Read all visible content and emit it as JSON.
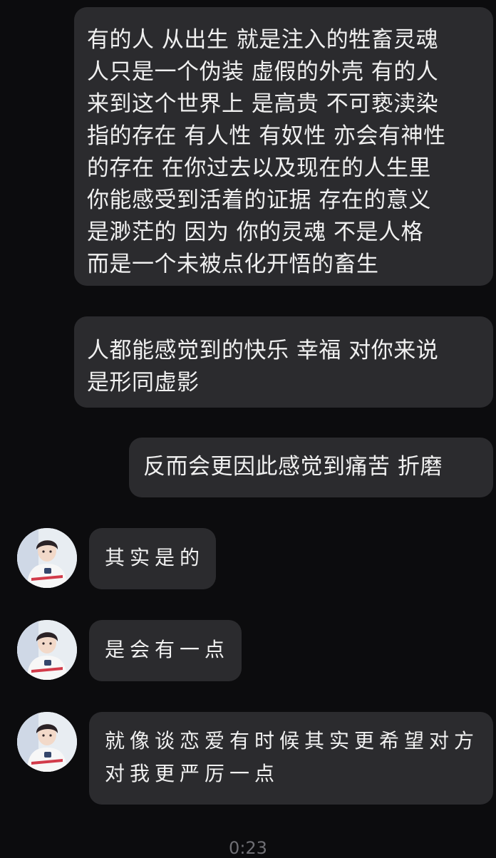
{
  "theme": {
    "background": "#0c0c0e",
    "bubble_color": "#2b2b2e",
    "text_color": "#f0f0f0"
  },
  "messages": [
    {
      "sender": "me",
      "lines": [
        "有的人 从出生 就是注入的牲畜灵魂",
        "人只是一个伪装 虚假的外壳 有的人",
        "来到这个世界上 是高贵 不可亵渎染",
        "指的存在 有人性 有奴性 亦会有神性",
        "的存在 在你过去以及现在的人生里",
        "你能感受到活着的证据 存在的意义",
        "是渺茫的 因为 你的灵魂 不是人格",
        "而是一个未被点化开悟的畜生"
      ]
    },
    {
      "sender": "me",
      "lines": [
        "人都能感觉到的快乐 幸福 对你来说",
        "是形同虚影"
      ]
    },
    {
      "sender": "me",
      "lines": [
        "反而会更因此感觉到痛苦 折磨"
      ]
    },
    {
      "sender": "other",
      "lines": [
        "其实是的"
      ]
    },
    {
      "sender": "other",
      "lines": [
        "是会有一点"
      ]
    },
    {
      "sender": "other",
      "lines": [
        "就像谈恋爱有时候其实更希望对方",
        "对我更严厉一点"
      ]
    }
  ],
  "avatar_icon": "user-avatar-photo",
  "footer": {
    "timestamp": "0:23"
  }
}
